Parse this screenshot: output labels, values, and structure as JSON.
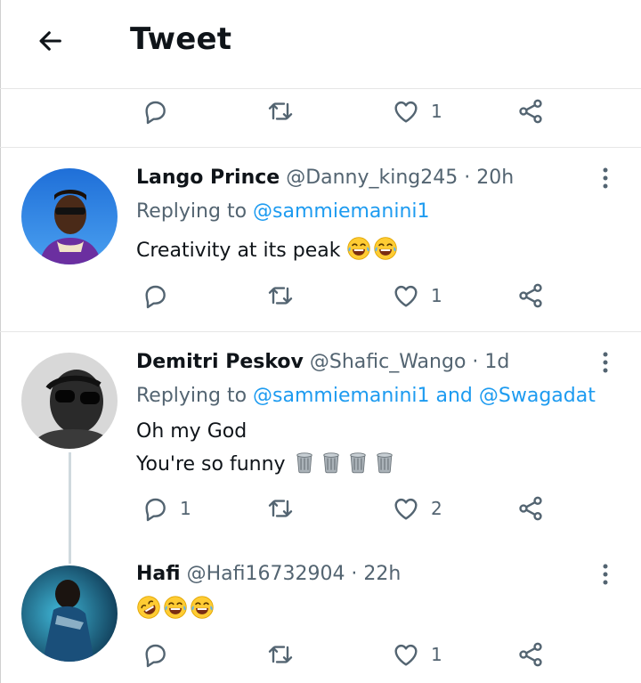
{
  "header": {
    "title": "Tweet"
  },
  "top_actions": {
    "like_count": "1"
  },
  "tweets": [
    {
      "name": "Lango Prince",
      "handle": "@Danny_king245",
      "time": "20h",
      "replying_prefix": "Replying to ",
      "mention1": "@sammiemanini1",
      "text1": "Creativity at its peak",
      "like_count": "1"
    },
    {
      "name": "Demitri Peskov",
      "handle": "@Shafic_Wango",
      "time": "1d",
      "replying_prefix": "Replying to ",
      "mention1": "@sammiemanini1",
      "and": " and ",
      "mention2": "@Swagadat",
      "text1": "Oh my God",
      "text2": "You're so funny",
      "reply_count": "1",
      "like_count": "2"
    },
    {
      "name": "Hafi",
      "handle": "@Hafi16732904",
      "time": "22h",
      "like_count": "1"
    }
  ],
  "separator": " · ",
  "colors": {
    "accent": "#1d9bf0",
    "secondary": "#536471",
    "border": "#e6e6e6"
  },
  "icons": [
    "back-arrow-icon",
    "reply-icon",
    "retweet-icon",
    "like-icon",
    "share-icon",
    "more-icon"
  ]
}
